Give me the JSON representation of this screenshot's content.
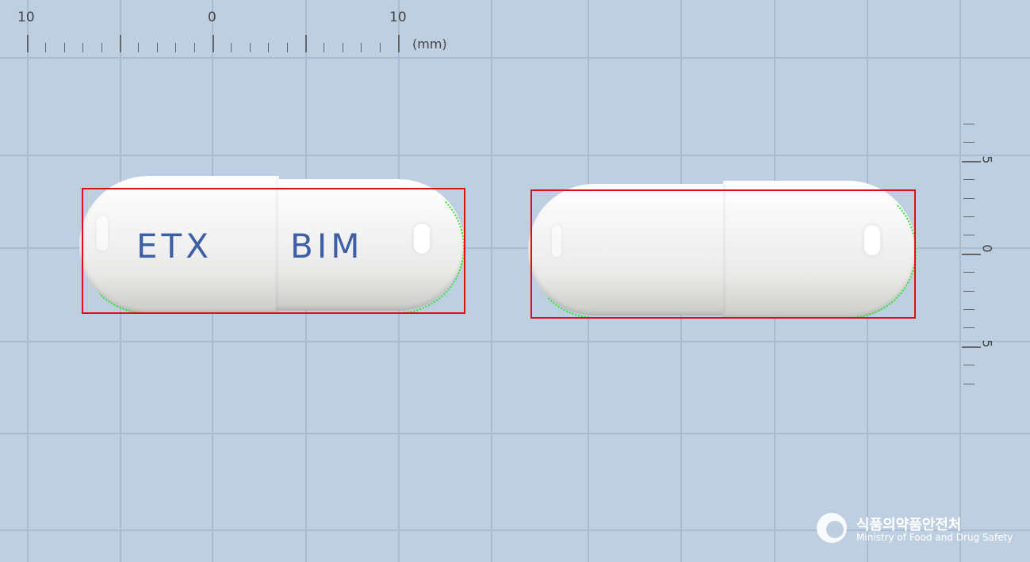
{
  "ruler_top": {
    "labels": [
      "10",
      "0",
      "10"
    ],
    "unit": "(mm)"
  },
  "ruler_right": {
    "labels": [
      "5",
      "0",
      "5"
    ]
  },
  "capsules": [
    {
      "id": "front",
      "imprint_left": "ETX",
      "imprint_right": "BIM"
    },
    {
      "id": "back",
      "imprint_left": "",
      "imprint_right": ""
    }
  ],
  "logo": {
    "name_ko": "식품의약품안전처",
    "name_en": "Ministry of Food and Drug Safety"
  },
  "colors": {
    "background": "#bfcfe2",
    "capsule": "#eeeeee",
    "imprint": "#3e5fa5",
    "bounding_box": "#e01010",
    "contour": "#2de82d"
  }
}
